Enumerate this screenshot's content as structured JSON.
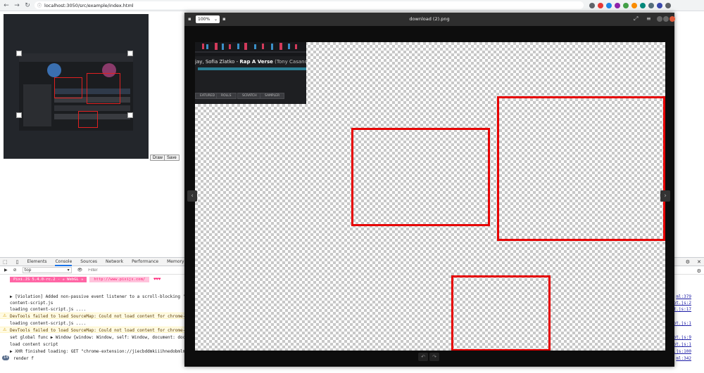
{
  "browser": {
    "url": "localhost:3050/src/example/index.html",
    "back_icon": "back-arrow-icon",
    "forward_icon": "forward-arrow-icon",
    "reload_icon": "reload-icon"
  },
  "page": {
    "draw_label": "Draw",
    "save_label": "Save"
  },
  "viewer": {
    "title": "download (2).png",
    "zoom": "100%",
    "track_artist": "jay, Sofia Zlatko - ",
    "track_title": "Rap A Verse",
    "track_sub": " (Tony Casanova",
    "pad_buttons": [
      "EATURED",
      "ROLLS",
      "SCRATCH",
      "SAMPLER"
    ],
    "box_color": "#e60000"
  },
  "devtools": {
    "tabs": [
      "Elements",
      "Console",
      "Sources",
      "Network",
      "Performance",
      "Memory"
    ],
    "active_tab": "Console",
    "context": "top",
    "filter_placeholder": "Filter",
    "pixi_version": "Pixi.JS 5.4.0-rc.2 - ✰ WebGL ✰",
    "pixi_url": "http://www.pixijs.com/",
    "pixi_hearts": "♥♥♥",
    "logs": [
      {
        "text": "▶ [Violation] Added non-passive event listener to a scroll-blocking 'wheel'",
        "type": "info",
        "src": "ml:379"
      },
      {
        "text": "content-script.js",
        "type": "log",
        "src": "ot.js:2"
      },
      {
        "text": "loading content-script.js ....",
        "type": "log",
        "src": "ot.js:17"
      },
      {
        "text": "DevTools failed to load SourceMap: Could not load content for chrome-extensi",
        "type": "warn",
        "src": ""
      },
      {
        "text": "loading content-script.js ....",
        "type": "log",
        "src": "ot.js:1"
      },
      {
        "text": "DevTools failed to load SourceMap: Could not load content for chrome-extensi",
        "type": "warn",
        "src": ""
      },
      {
        "text": "set global func ▶ Window {window: Window, self: Window, document: document,",
        "type": "log",
        "src": "ot.js:9"
      },
      {
        "text": "load content script",
        "type": "log",
        "src": "ot.js:1"
      },
      {
        "text": "▶ XHR finished loading: GET \"chrome-extension://jiecbddmkiiihnedobmlmillhod",
        "type": "log",
        "src": "ot.js:100"
      },
      {
        "text": "render f",
        "type": "log",
        "src": "ml:342"
      }
    ],
    "repeat_count": "14"
  }
}
